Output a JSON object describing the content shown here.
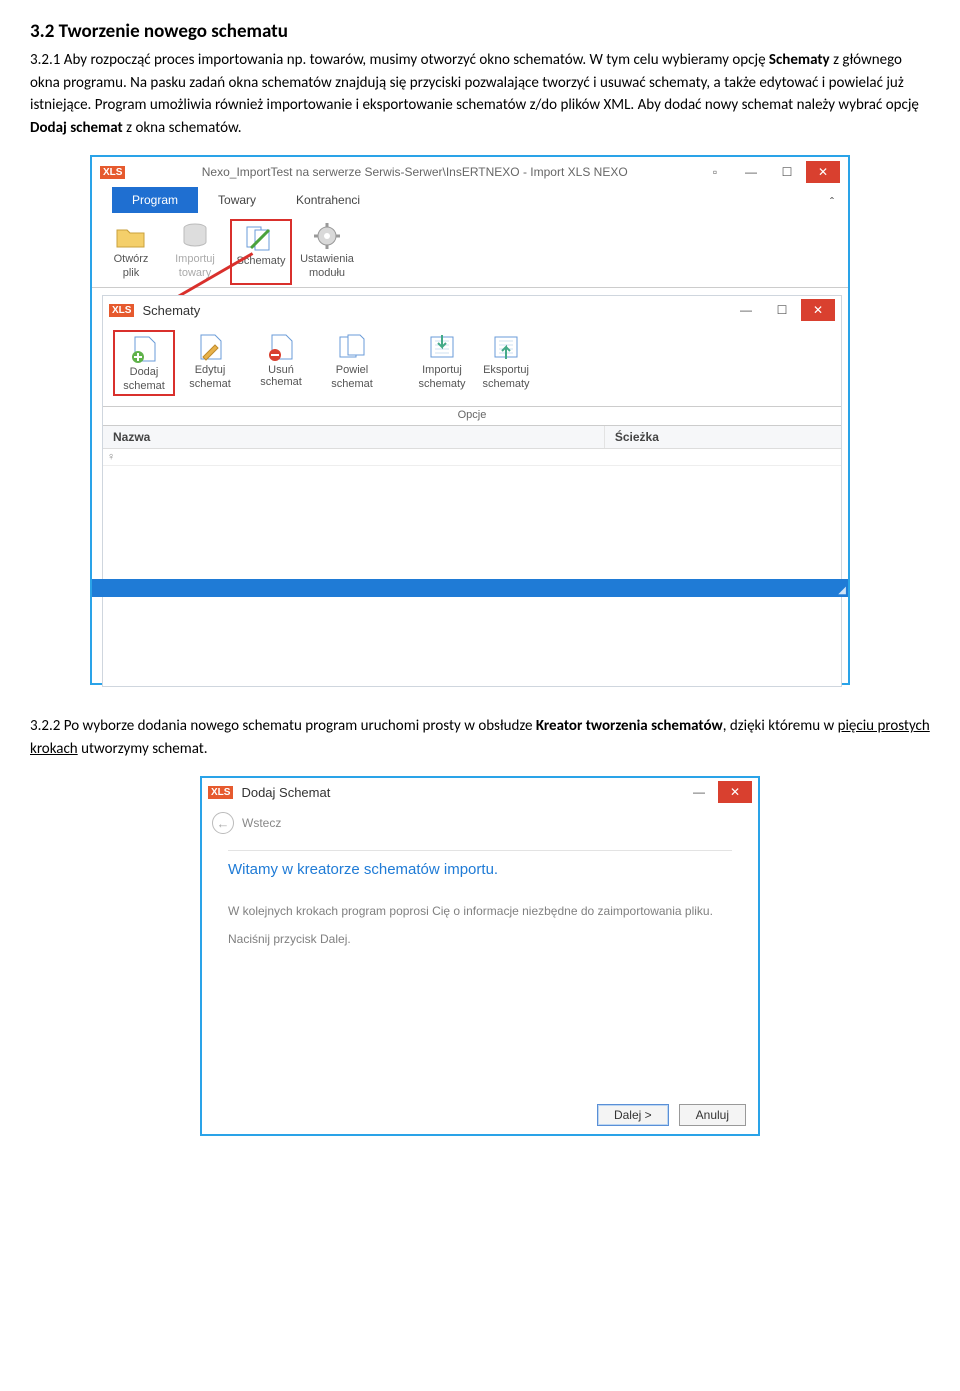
{
  "doc": {
    "h1": "3.2 Tworzenie nowego schematu",
    "p1_a": "3.2.1 Aby rozpocząć proces importowania np. towarów, musimy otworzyć okno schematów. W tym celu wybieramy opcję ",
    "p1_b": "Schematy",
    "p1_c": " z głównego okna programu. Na pasku zadań okna schematów znajdują się przyciski pozwalające tworzyć i usuwać schematy, a także edytować i powielać już istniejące. Program umożliwia również importowanie i eksportowanie schematów z/do plików XML. Aby dodać nowy schemat należy wybrać opcję ",
    "p1_d": "Dodaj schemat",
    "p1_e": " z okna schematów.",
    "p2_a": "3.2.2 Po wyborze dodania nowego schematu program uruchomi prosty w obsłudze ",
    "p2_b": "Kreator tworzenia schematów",
    "p2_c": ", dzięki któremu w ",
    "p2_d": "pięciu prostych krokach",
    "p2_e": " utworzymy schemat."
  },
  "shot1": {
    "xls": "XLS",
    "title": "Nexo_ImportTest na serwerze Serwis-Serwer\\InsERTNEXO - Import XLS NEXO",
    "tabs": {
      "program": "Program",
      "towary": "Towary",
      "kontrahenci": "Kontrahenci"
    },
    "ribbon": {
      "otworz1": "Otwórz",
      "otworz2": "plik",
      "importuj1": "Importuj",
      "importuj2": "towary",
      "schematy": "Schematy",
      "ust1": "Ustawienia",
      "ust2": "modułu"
    },
    "sub": {
      "title": "Schematy",
      "dodaj1": "Dodaj",
      "dodaj2": "schemat",
      "edytuj1": "Edytuj",
      "edytuj2": "schemat",
      "usun": "Usuń schemat",
      "powiel1": "Powiel",
      "powiel2": "schemat",
      "imp1": "Importuj",
      "imp2": "schematy",
      "eks1": "Eksportuj",
      "eks2": "schematy",
      "opcje": "Opcje",
      "col_nazwa": "Nazwa",
      "col_sciezka": "Ścieżka",
      "filter": "♀"
    }
  },
  "shot2": {
    "xls": "XLS",
    "title": "Dodaj Schemat",
    "back": "Wstecz",
    "heading": "Witamy w kreatorze schematów importu.",
    "p1": "W kolejnych krokach program poprosi Cię o informacje niezbędne do zaimportowania pliku.",
    "p2": "Naciśnij przycisk Dalej.",
    "btn_next": "Dalej >",
    "btn_cancel": "Anuluj"
  }
}
